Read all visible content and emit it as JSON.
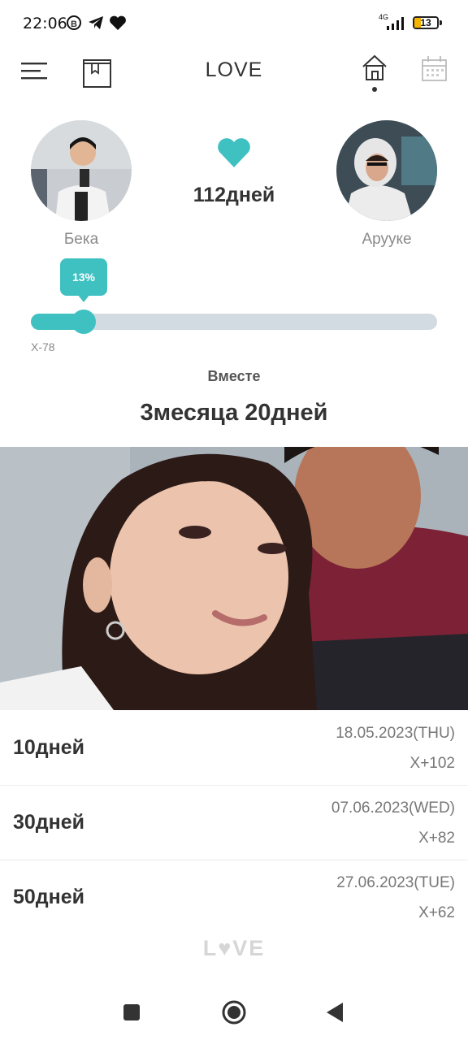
{
  "status_bar": {
    "time": "22:06",
    "b_badge": "B",
    "network": "4G",
    "battery": "13"
  },
  "nav": {
    "title": "LOVE",
    "icons": [
      "menu-icon",
      "album-icon",
      "home-icon",
      "calendar-icon"
    ]
  },
  "couple": {
    "left_name": "Бека",
    "right_name": "Арууке",
    "days": "112дней"
  },
  "progress": {
    "percent_label": "13%",
    "value": 0.13,
    "countdown": "X-78"
  },
  "summary": {
    "label": "Вместе",
    "duration": "3месяца 20дней"
  },
  "milestones": [
    {
      "title": "10дней",
      "date": "18.05.2023(THU)",
      "relative": "X+102"
    },
    {
      "title": "30дней",
      "date": "07.06.2023(WED)",
      "relative": "X+82"
    },
    {
      "title": "50дней",
      "date": "27.06.2023(TUE)",
      "relative": "X+62"
    }
  ],
  "footer": {
    "logo_text": "L♥VE"
  },
  "colors": {
    "accent": "#3fc1c1",
    "track": "#d3dbe2",
    "text": "#333333",
    "muted": "#888888"
  }
}
